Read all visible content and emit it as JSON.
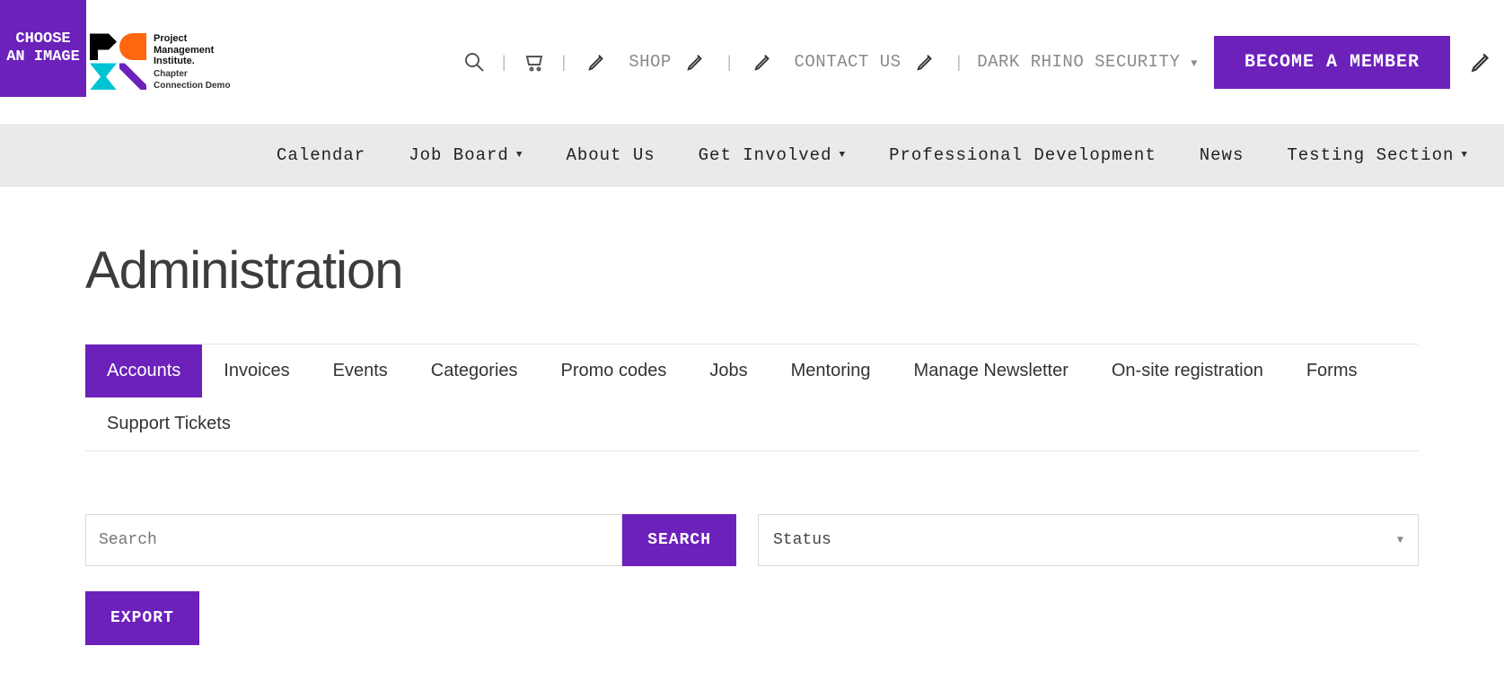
{
  "badge": "CHOOSE AN IMAGE",
  "logo": {
    "line1": "Project",
    "line2": "Management",
    "line3": "Institute.",
    "sub1": "Chapter",
    "sub2": "Connection Demo"
  },
  "top": {
    "shop": "SHOP",
    "contact": "CONTACT US",
    "user": "DARK RHINO SECURITY",
    "cta": "BECOME A MEMBER"
  },
  "nav": {
    "calendar": "Calendar",
    "jobboard": "Job Board",
    "about": "About Us",
    "involved": "Get Involved",
    "profdev": "Professional Development",
    "news": "News",
    "testing": "Testing Section"
  },
  "page": {
    "title": "Administration"
  },
  "tabs": {
    "accounts": "Accounts",
    "invoices": "Invoices",
    "events": "Events",
    "categories": "Categories",
    "promo": "Promo codes",
    "jobs": "Jobs",
    "mentoring": "Mentoring",
    "newsletter": "Manage Newsletter",
    "onsite": "On-site registration",
    "forms": "Forms",
    "tickets": "Support Tickets"
  },
  "search": {
    "placeholder": "Search",
    "button": "SEARCH"
  },
  "status": {
    "label": "Status"
  },
  "export": "EXPORT"
}
